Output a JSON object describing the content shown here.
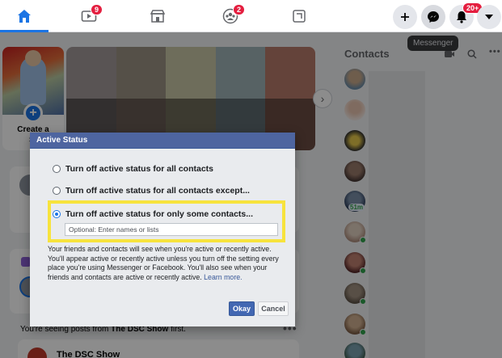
{
  "nav": {
    "tabs": [
      {
        "name": "home",
        "icon": "home-icon",
        "active": true
      },
      {
        "name": "watch",
        "icon": "video-icon",
        "badge": "9"
      },
      {
        "name": "marketplace",
        "icon": "store-icon"
      },
      {
        "name": "groups",
        "icon": "groups-icon",
        "badge": "2"
      },
      {
        "name": "gaming",
        "icon": "gaming-icon"
      }
    ],
    "notifications_badge": "20+",
    "tooltip": "Messenger"
  },
  "stories": {
    "create_label": "Create a\nSt"
  },
  "feed": {
    "seeing_posts_prefix": "You're seeing posts from ",
    "seeing_posts_page": "The DSC Show",
    "seeing_posts_suffix": " first.",
    "post_author": "The DSC Show"
  },
  "contacts": {
    "title": "Contacts",
    "active_badge": "51m"
  },
  "dialog": {
    "title": "Active Status",
    "options": [
      "Turn off active status for all contacts",
      "Turn off active status for all contacts except...",
      "Turn off active status for only some contacts..."
    ],
    "selected_option": 2,
    "names_placeholder": "Optional: Enter names or lists",
    "description": "Your friends and contacts will see when you're active or recently active. You'll appear active or recently active unless you turn off the setting every place you're using Messenger or Facebook. You'll also see when your friends and contacts are active or recently active.",
    "learn_more": "Learn more.",
    "okay_label": "Okay",
    "cancel_label": "Cancel"
  },
  "colors": {
    "accent": "#1b74e4",
    "highlight": "#f7e33d",
    "dialog_header": "#4e65a0"
  }
}
